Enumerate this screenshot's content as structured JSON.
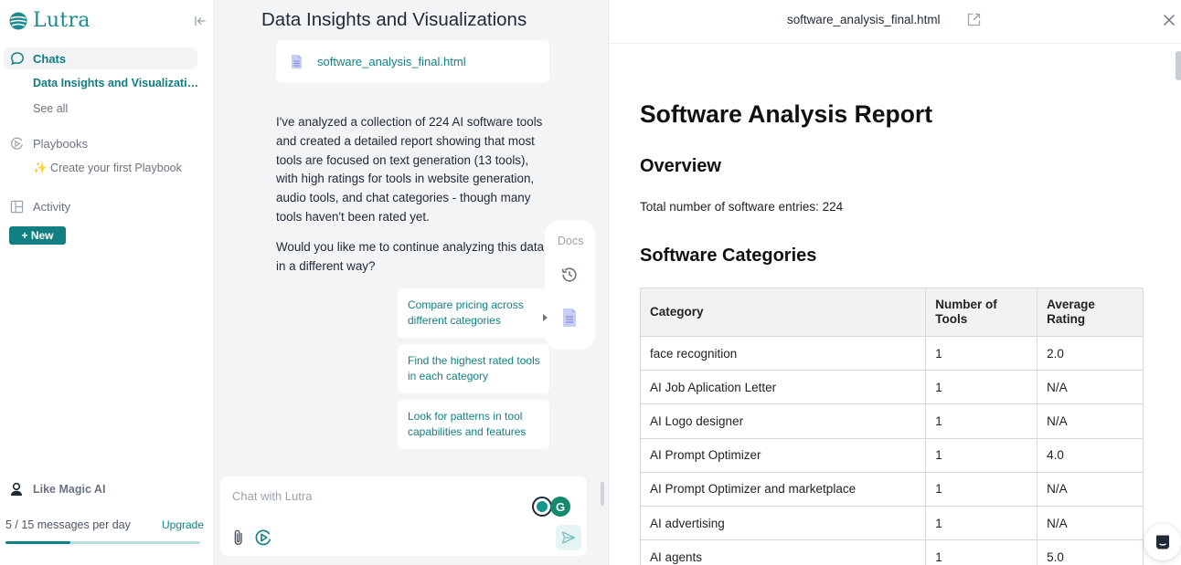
{
  "sidebar": {
    "brand": "Lutra",
    "nav_chats": "Chats",
    "active_chat": "Data Insights and Visualizatio...",
    "see_all": "See all",
    "nav_playbooks": "Playbooks",
    "create_playbook": "✨ Create your first Playbook",
    "nav_activity": "Activity",
    "new_button": "+ New",
    "user_name": "Like Magic AI",
    "usage_text": "5 / 15 messages per day",
    "usage_fraction": 0.333,
    "upgrade_label": "Upgrade"
  },
  "chat": {
    "title": "Data Insights and Visualizations",
    "file_name": "software_analysis_final.html",
    "message_1": "I've analyzed a collection of 224 AI software tools and created a detailed report showing that most tools are focused on text generation (13 tools), with high ratings for tools in website generation, audio tools, and chat categories - though many tools haven't been rated yet.",
    "message_2": "Would you like me to continue analyzing this data in a different way?",
    "suggestions": [
      "Compare pricing across different categories",
      "Find the highest rated tools in each category",
      "Look for patterns in tool capabilities and features"
    ],
    "docs_label": "Docs",
    "composer_placeholder": "Chat with Lutra"
  },
  "viewer": {
    "file_title": "software_analysis_final.html",
    "report_title": "Software Analysis Report",
    "overview_heading": "Overview",
    "total_text": "Total number of software entries: 224",
    "categories_heading": "Software Categories",
    "table": {
      "headers": [
        "Category",
        "Number of Tools",
        "Average Rating"
      ],
      "rows": [
        [
          "face recognition",
          "1",
          "2.0"
        ],
        [
          "AI Job Aplication Letter",
          "1",
          "N/A"
        ],
        [
          "AI Logo designer",
          "1",
          "N/A"
        ],
        [
          "AI Prompt Optimizer",
          "1",
          "4.0"
        ],
        [
          "AI Prompt Optimizer and marketplace",
          "1",
          "N/A"
        ],
        [
          "AI advertising",
          "1",
          "N/A"
        ],
        [
          "AI agents",
          "1",
          "5.0"
        ]
      ]
    }
  },
  "colors": {
    "accent": "#127f83",
    "chat_bg": "#f3f4f5"
  }
}
